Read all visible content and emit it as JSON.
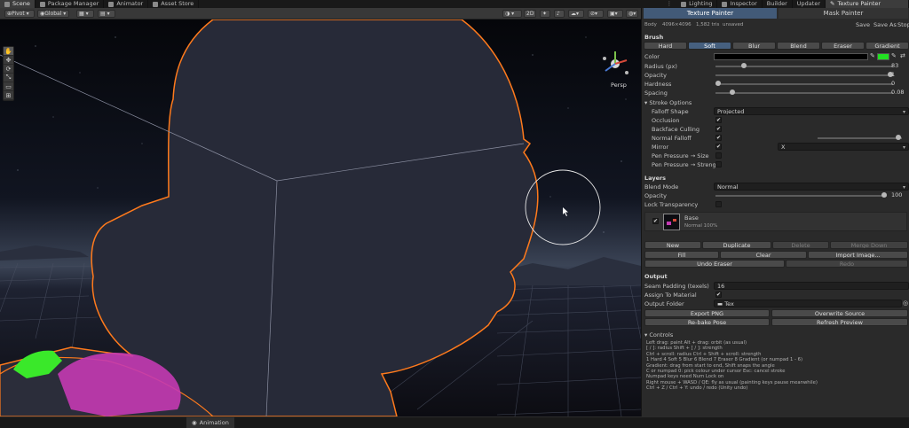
{
  "top_tabs": [
    {
      "label": "Scene",
      "active": true
    },
    {
      "label": "Package Manager",
      "active": false
    },
    {
      "label": "Animator",
      "active": false
    },
    {
      "label": "Asset Store",
      "active": false
    }
  ],
  "right_tabs": [
    {
      "label": "Lighting"
    },
    {
      "label": "Inspector"
    },
    {
      "label": "Builder"
    },
    {
      "label": "Updater"
    },
    {
      "label": "Texture Painter"
    }
  ],
  "scene_toolbar": {
    "pivot": "Pivot",
    "global": "Global",
    "mode_2d": "2D"
  },
  "scene_view": {
    "persp_label": "Persp"
  },
  "bottom_bar": {
    "animation_tab": "Animation"
  },
  "panel": {
    "modes": [
      "Texture Painter",
      "Mask Painter"
    ],
    "body_info": {
      "name": "Body",
      "resolution": "4096×4096",
      "tris": "1,582 tris",
      "state": "unsaved"
    },
    "save_actions": [
      "Save",
      "Save As",
      "Stop"
    ],
    "brush": {
      "header": "Brush",
      "types": [
        "Hard",
        "Soft",
        "Blur",
        "Blend",
        "Eraser",
        "Gradient"
      ],
      "selected_type": "Soft",
      "color_label": "Color",
      "color_primary": "#000000",
      "color_secondary": "#22e022",
      "radius_label": "Radius (px)",
      "radius": "83",
      "radius_fraction": 0.15,
      "opacity_label": "Opacity",
      "opacity": "1",
      "opacity_fraction": 1.0,
      "hardness_label": "Hardness",
      "hardness": "0",
      "hardness_fraction": 0.0,
      "spacing_label": "Spacing",
      "spacing": "0.08",
      "spacing_fraction": 0.08
    },
    "stroke": {
      "header": "Stroke Options",
      "falloff_label": "Falloff Shape",
      "falloff_value": "Projected",
      "occlusion_label": "Occlusion",
      "backface_label": "Backface Culling",
      "normal_falloff_label": "Normal Falloff",
      "mirror_label": "Mirror",
      "mirror_axis": "X",
      "pen_size_label": "Pen Pressure → Size",
      "pen_strength_label": "Pen Pressure → Strength"
    },
    "layers": {
      "header": "Layers",
      "blend_label": "Blend Mode",
      "blend_value": "Normal",
      "opacity_label": "Opacity",
      "opacity": "100",
      "opacity_fraction": 1.0,
      "lock_label": "Lock Transparency",
      "layer_name": "Base",
      "layer_info": "Normal 100%",
      "buttons": [
        "New",
        "Duplicate",
        "Delete",
        "Merge Down"
      ],
      "buttons2": [
        "Fill",
        "Clear",
        "Import Image..."
      ],
      "buttons3": [
        "Undo Eraser",
        "Redo"
      ]
    },
    "output": {
      "header": "Output",
      "seam_label": "Seam Padding (texels)",
      "seam_value": "16",
      "assign_label": "Assign To Material",
      "folder_label": "Output Folder",
      "folder_value": "Tex",
      "buttons": [
        "Export PNG",
        "Overwrite Source",
        "Re-bake Pose",
        "Refresh Preview"
      ]
    },
    "controls": {
      "header": "Controls",
      "lines": [
        "Left drag: paint    Alt + drag: orbit (as usual)",
        "[ / ]: radius    Shift + [ / ]: strength",
        "Ctrl + scroll: radius    Ctrl + Shift + scroll: strength",
        "1 Hard  4 Soft  5 Blur  6 Blend  7 Eraser  8 Gradient    (or numpad 1 - 6)",
        "Gradient: drag from start to end, Shift snaps the angle",
        "C or numpad 0: pick colour under cursor    Esc: cancel stroke",
        "Numpad keys need Num Lock on",
        "Right mouse + WASD / QE: fly as usual (painting keys pause meanwhile)",
        "Ctrl + Z / Ctrl + Y: undo / redo (Unity undo)"
      ]
    }
  }
}
